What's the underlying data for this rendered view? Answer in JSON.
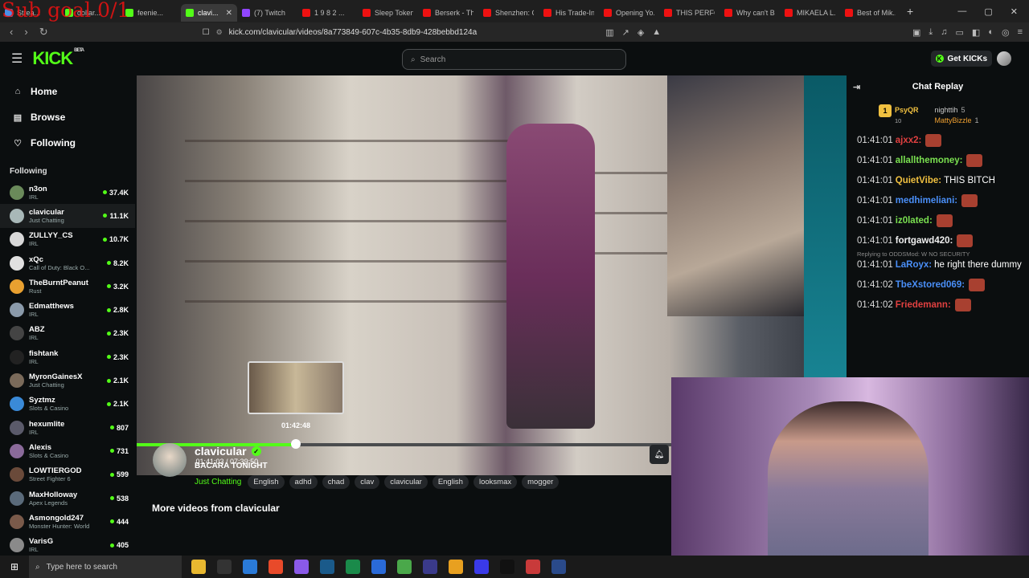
{
  "overlay": {
    "sub_goal": "Sub goal 0/1"
  },
  "browser": {
    "tabs": [
      {
        "title": "Strea...",
        "color": "#4a8fe8"
      },
      {
        "title": "dollar...",
        "color": "#53fc18"
      },
      {
        "title": "feenie...",
        "color": "#53fc18"
      },
      {
        "title": "clavi...",
        "color": "#53fc18",
        "active": true
      },
      {
        "title": "(7) Twitch",
        "color": "#9146ff"
      },
      {
        "title": "1 9 8 2 ...",
        "color": "#e11"
      },
      {
        "title": "Sleep Token",
        "color": "#e11"
      },
      {
        "title": "Berserk - Th...",
        "color": "#e11"
      },
      {
        "title": "Shenzhen: C...",
        "color": "#e11"
      },
      {
        "title": "His Trade-In...",
        "color": "#e11"
      },
      {
        "title": "Opening Yo...",
        "color": "#e11"
      },
      {
        "title": "THIS PERFO...",
        "color": "#e11"
      },
      {
        "title": "Why can't B...",
        "color": "#e11"
      },
      {
        "title": "MIKAELA L...",
        "color": "#e11"
      },
      {
        "title": "Best of Mik...",
        "color": "#e11"
      }
    ],
    "url": "kick.com/clavicular/videos/8a773849-607c-4b35-8db9-428bebbd124a"
  },
  "topnav": {
    "search_placeholder": "Search",
    "get_kicks": "Get KICKs",
    "logo": "KICK",
    "logo_badge": "BETA"
  },
  "sidebar": {
    "nav": [
      {
        "label": "Home",
        "icon": "⌂"
      },
      {
        "label": "Browse",
        "icon": "▤"
      },
      {
        "label": "Following",
        "icon": "♡"
      }
    ],
    "following_header": "Following",
    "channels": [
      {
        "name": "n3on",
        "category": "IRL",
        "viewers": "37.4K",
        "color": "#6a8a5a"
      },
      {
        "name": "clavicular",
        "category": "Just Chatting",
        "viewers": "11.1K",
        "color": "#a8b8b8",
        "active": true
      },
      {
        "name": "ZULLYY_CS",
        "category": "IRL",
        "viewers": "10.7K",
        "color": "#d8d8d8"
      },
      {
        "name": "xQc",
        "category": "Call of Duty: Black O...",
        "viewers": "8.2K",
        "color": "#e0e0e0"
      },
      {
        "name": "TheBurntPeanut",
        "category": "Rust",
        "viewers": "3.2K",
        "color": "#e8a030"
      },
      {
        "name": "Edmatthews",
        "category": "IRL",
        "viewers": "2.8K",
        "color": "#8a9aaa"
      },
      {
        "name": "ABZ",
        "category": "IRL",
        "viewers": "2.3K",
        "color": "#444"
      },
      {
        "name": "fishtank",
        "category": "IRL",
        "viewers": "2.3K",
        "color": "#222"
      },
      {
        "name": "MyronGainesX",
        "category": "Just Chatting",
        "viewers": "2.1K",
        "color": "#7a6a5a"
      },
      {
        "name": "Syztmz",
        "category": "Slots & Casino",
        "viewers": "2.1K",
        "color": "#3a8ad8"
      },
      {
        "name": "hexumlite",
        "category": "IRL",
        "viewers": "807",
        "color": "#5a5a6a"
      },
      {
        "name": "Alexis",
        "category": "Slots & Casino",
        "viewers": "731",
        "color": "#8a6a9a"
      },
      {
        "name": "LOWTIERGOD",
        "category": "Street Fighter 6",
        "viewers": "599",
        "color": "#6a4a3a"
      },
      {
        "name": "MaxHolloway",
        "category": "Apex Legends",
        "viewers": "538",
        "color": "#5a6a7a"
      },
      {
        "name": "Asmongold247",
        "category": "Monster Hunter: World",
        "viewers": "444",
        "color": "#7a5a4a"
      },
      {
        "name": "VarisG",
        "category": "IRL",
        "viewers": "405",
        "color": "#8a8a8a"
      }
    ]
  },
  "player": {
    "hover_time": "01:42:48",
    "time": "01:41:03 / 07:39:50",
    "progress": 0.296,
    "hover_pos": 0.298
  },
  "channel": {
    "name": "clavicular",
    "title": "BACARA TONIGHT",
    "category": "Just Chatting",
    "tags": [
      "English",
      "adhd",
      "chad",
      "clav",
      "clavicular",
      "English",
      "looksmax",
      "mogger"
    ]
  },
  "more_videos": "More videos from clavicular",
  "chat": {
    "header": "Chat Replay",
    "pinned": {
      "badge": "1",
      "user1": "PsyQR",
      "count1": "10",
      "user2": "nighttih",
      "count2": "5",
      "user3": "MattyBizzle",
      "count3": "1"
    },
    "messages": [
      {
        "time": "01:41:01",
        "user": "ajxx2:",
        "color": "#e04040",
        "text": ""
      },
      {
        "time": "01:41:01",
        "user": "allallthemoney:",
        "color": "#7ae050",
        "text": ""
      },
      {
        "time": "01:41:01",
        "user": "QuietVibe:",
        "color": "#f0c040",
        "text": "THIS BITCH"
      },
      {
        "time": "01:41:01",
        "user": "medhimeliani:",
        "color": "#4a8ff8",
        "text": ""
      },
      {
        "time": "01:41:01",
        "user": "iz0lated:",
        "color": "#7ae050",
        "text": ""
      },
      {
        "time": "01:41:01",
        "user": "fortgawd420:",
        "color": "#f0f0f0",
        "text": ""
      },
      {
        "time": "01:41:01",
        "user": "LaRoyx:",
        "color": "#4a8ff8",
        "text": "he right there dummy",
        "reply": "Replying to ODDSMod: W NO SECURITY"
      },
      {
        "time": "01:41:02",
        "user": "TbeXstored069:",
        "color": "#4a8ff8",
        "text": ""
      },
      {
        "time": "01:41:02",
        "user": "Friedemann:",
        "color": "#e04040",
        "text": ""
      }
    ]
  },
  "taskbar": {
    "search_placeholder": "Type here to search"
  }
}
